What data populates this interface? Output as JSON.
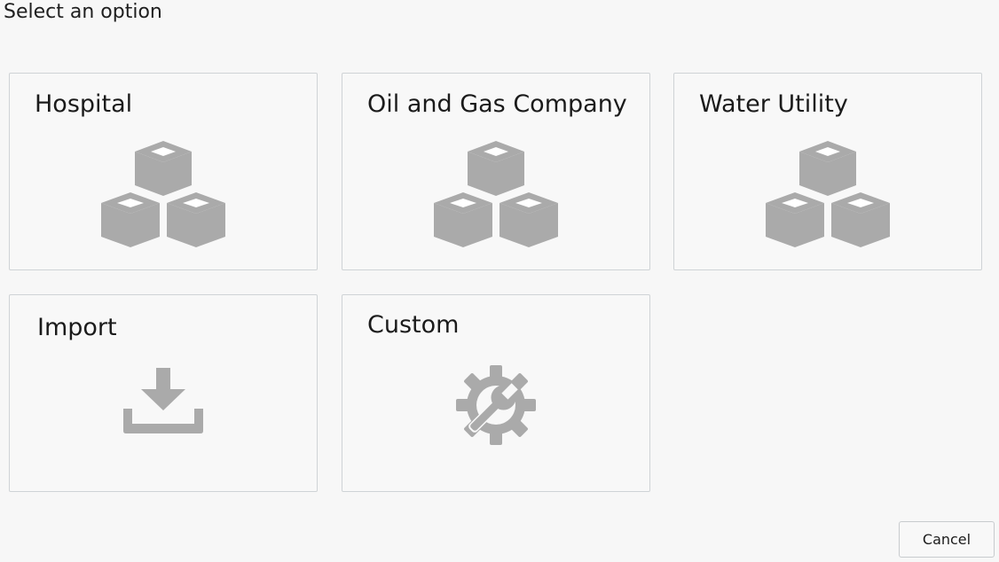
{
  "page": {
    "heading": "Select an option"
  },
  "options": [
    {
      "label": "Hospital",
      "icon": "cubes-icon"
    },
    {
      "label": "Oil and Gas Company",
      "icon": "cubes-icon"
    },
    {
      "label": "Water Utility",
      "icon": "cubes-icon"
    },
    {
      "label": "Import",
      "icon": "download-icon"
    },
    {
      "label": "Custom",
      "icon": "settings-icon"
    }
  ],
  "footer": {
    "cancel_label": "Cancel"
  },
  "colors": {
    "background": "#f7f7f7",
    "card_border": "#cfd3d6",
    "icon_gray": "#aaaaaa",
    "text": "#1b1b1b"
  }
}
